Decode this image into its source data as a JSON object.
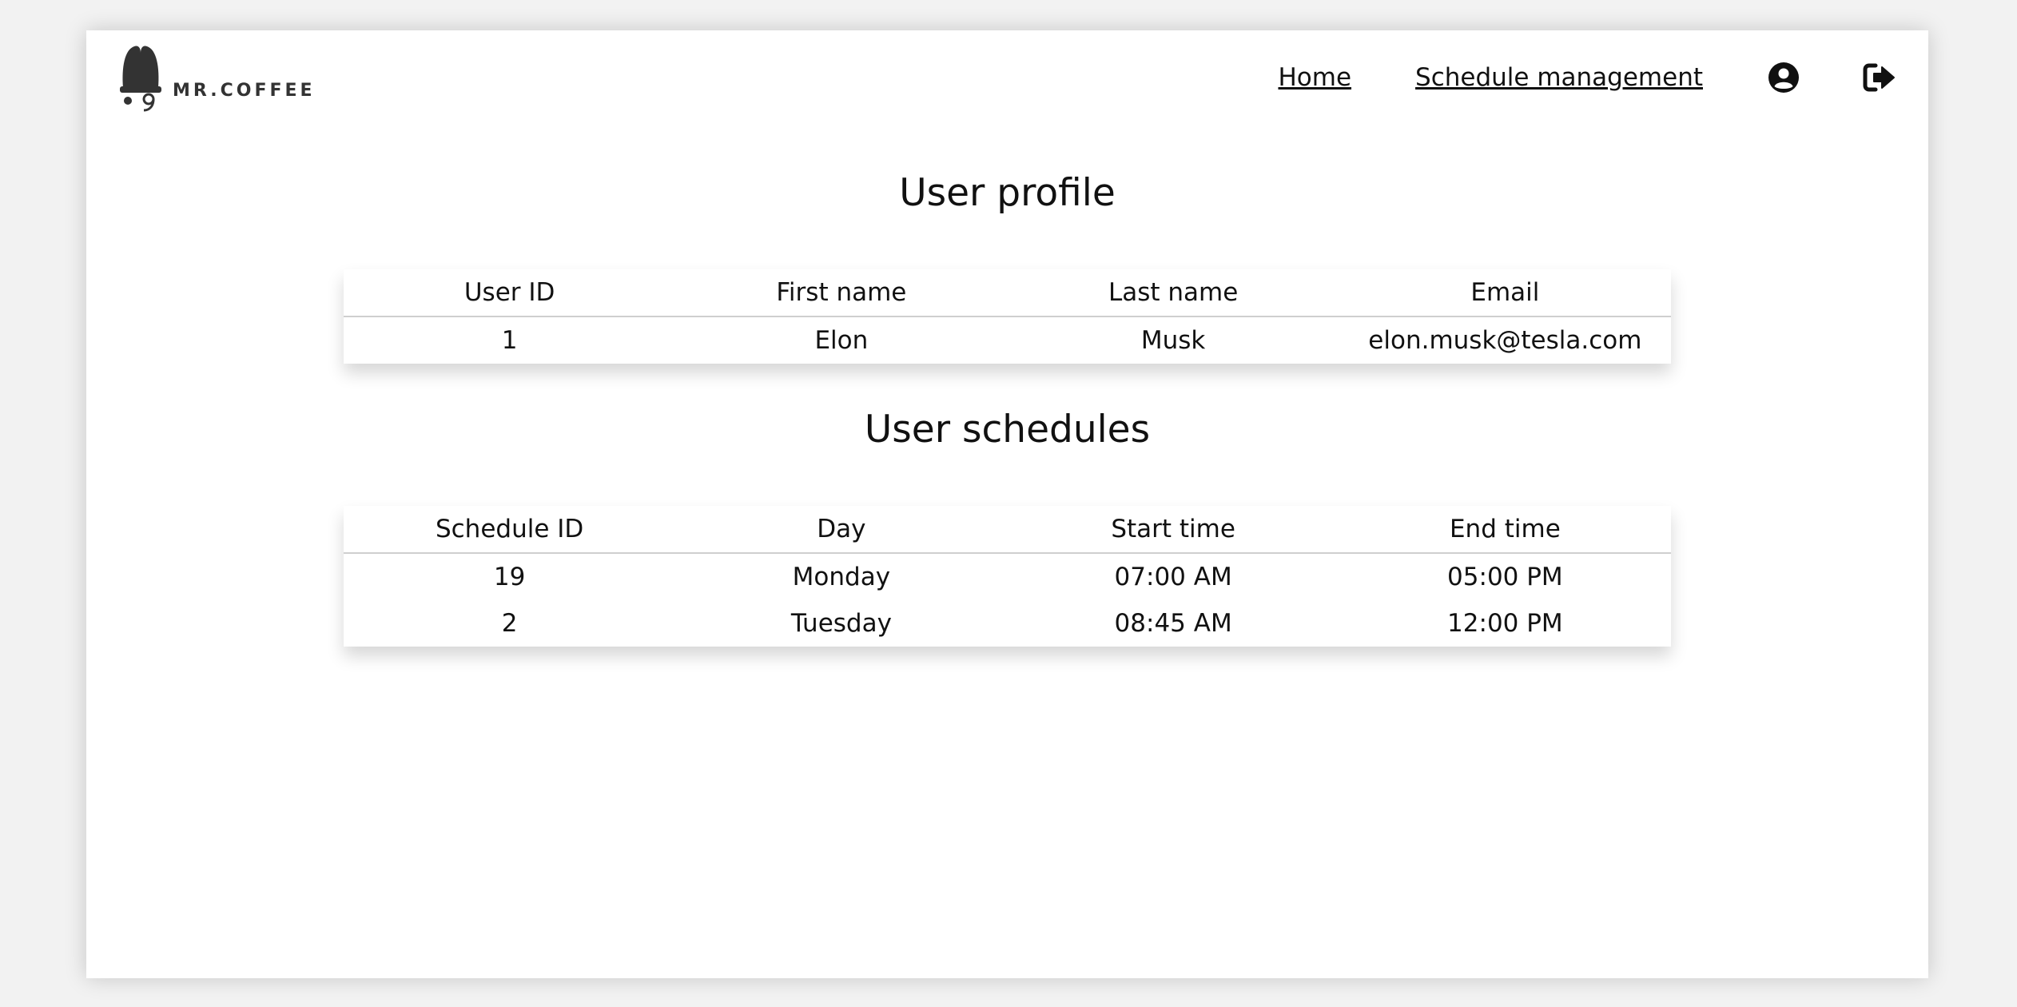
{
  "brand": {
    "name": "MR.COFFEE"
  },
  "nav": {
    "home_label": "Home",
    "schedule_label": "Schedule management",
    "profile_icon": "user-circle-icon",
    "logout_icon": "sign-out-icon"
  },
  "profile": {
    "title": "User profile",
    "headers": [
      "User ID",
      "First name",
      "Last name",
      "Email"
    ],
    "rows": [
      [
        "1",
        "Elon",
        "Musk",
        "elon.musk@tesla.com"
      ]
    ]
  },
  "schedules": {
    "title": "User schedules",
    "headers": [
      "Schedule ID",
      "Day",
      "Start time",
      "End time"
    ],
    "rows": [
      [
        "19",
        "Monday",
        "07:00 AM",
        "05:00 PM"
      ],
      [
        "2",
        "Tuesday",
        "08:45 AM",
        "12:00 PM"
      ]
    ]
  },
  "colors": {
    "text": "#111111",
    "page_bg": "#ffffff",
    "backdrop": "#f2f2f2"
  }
}
